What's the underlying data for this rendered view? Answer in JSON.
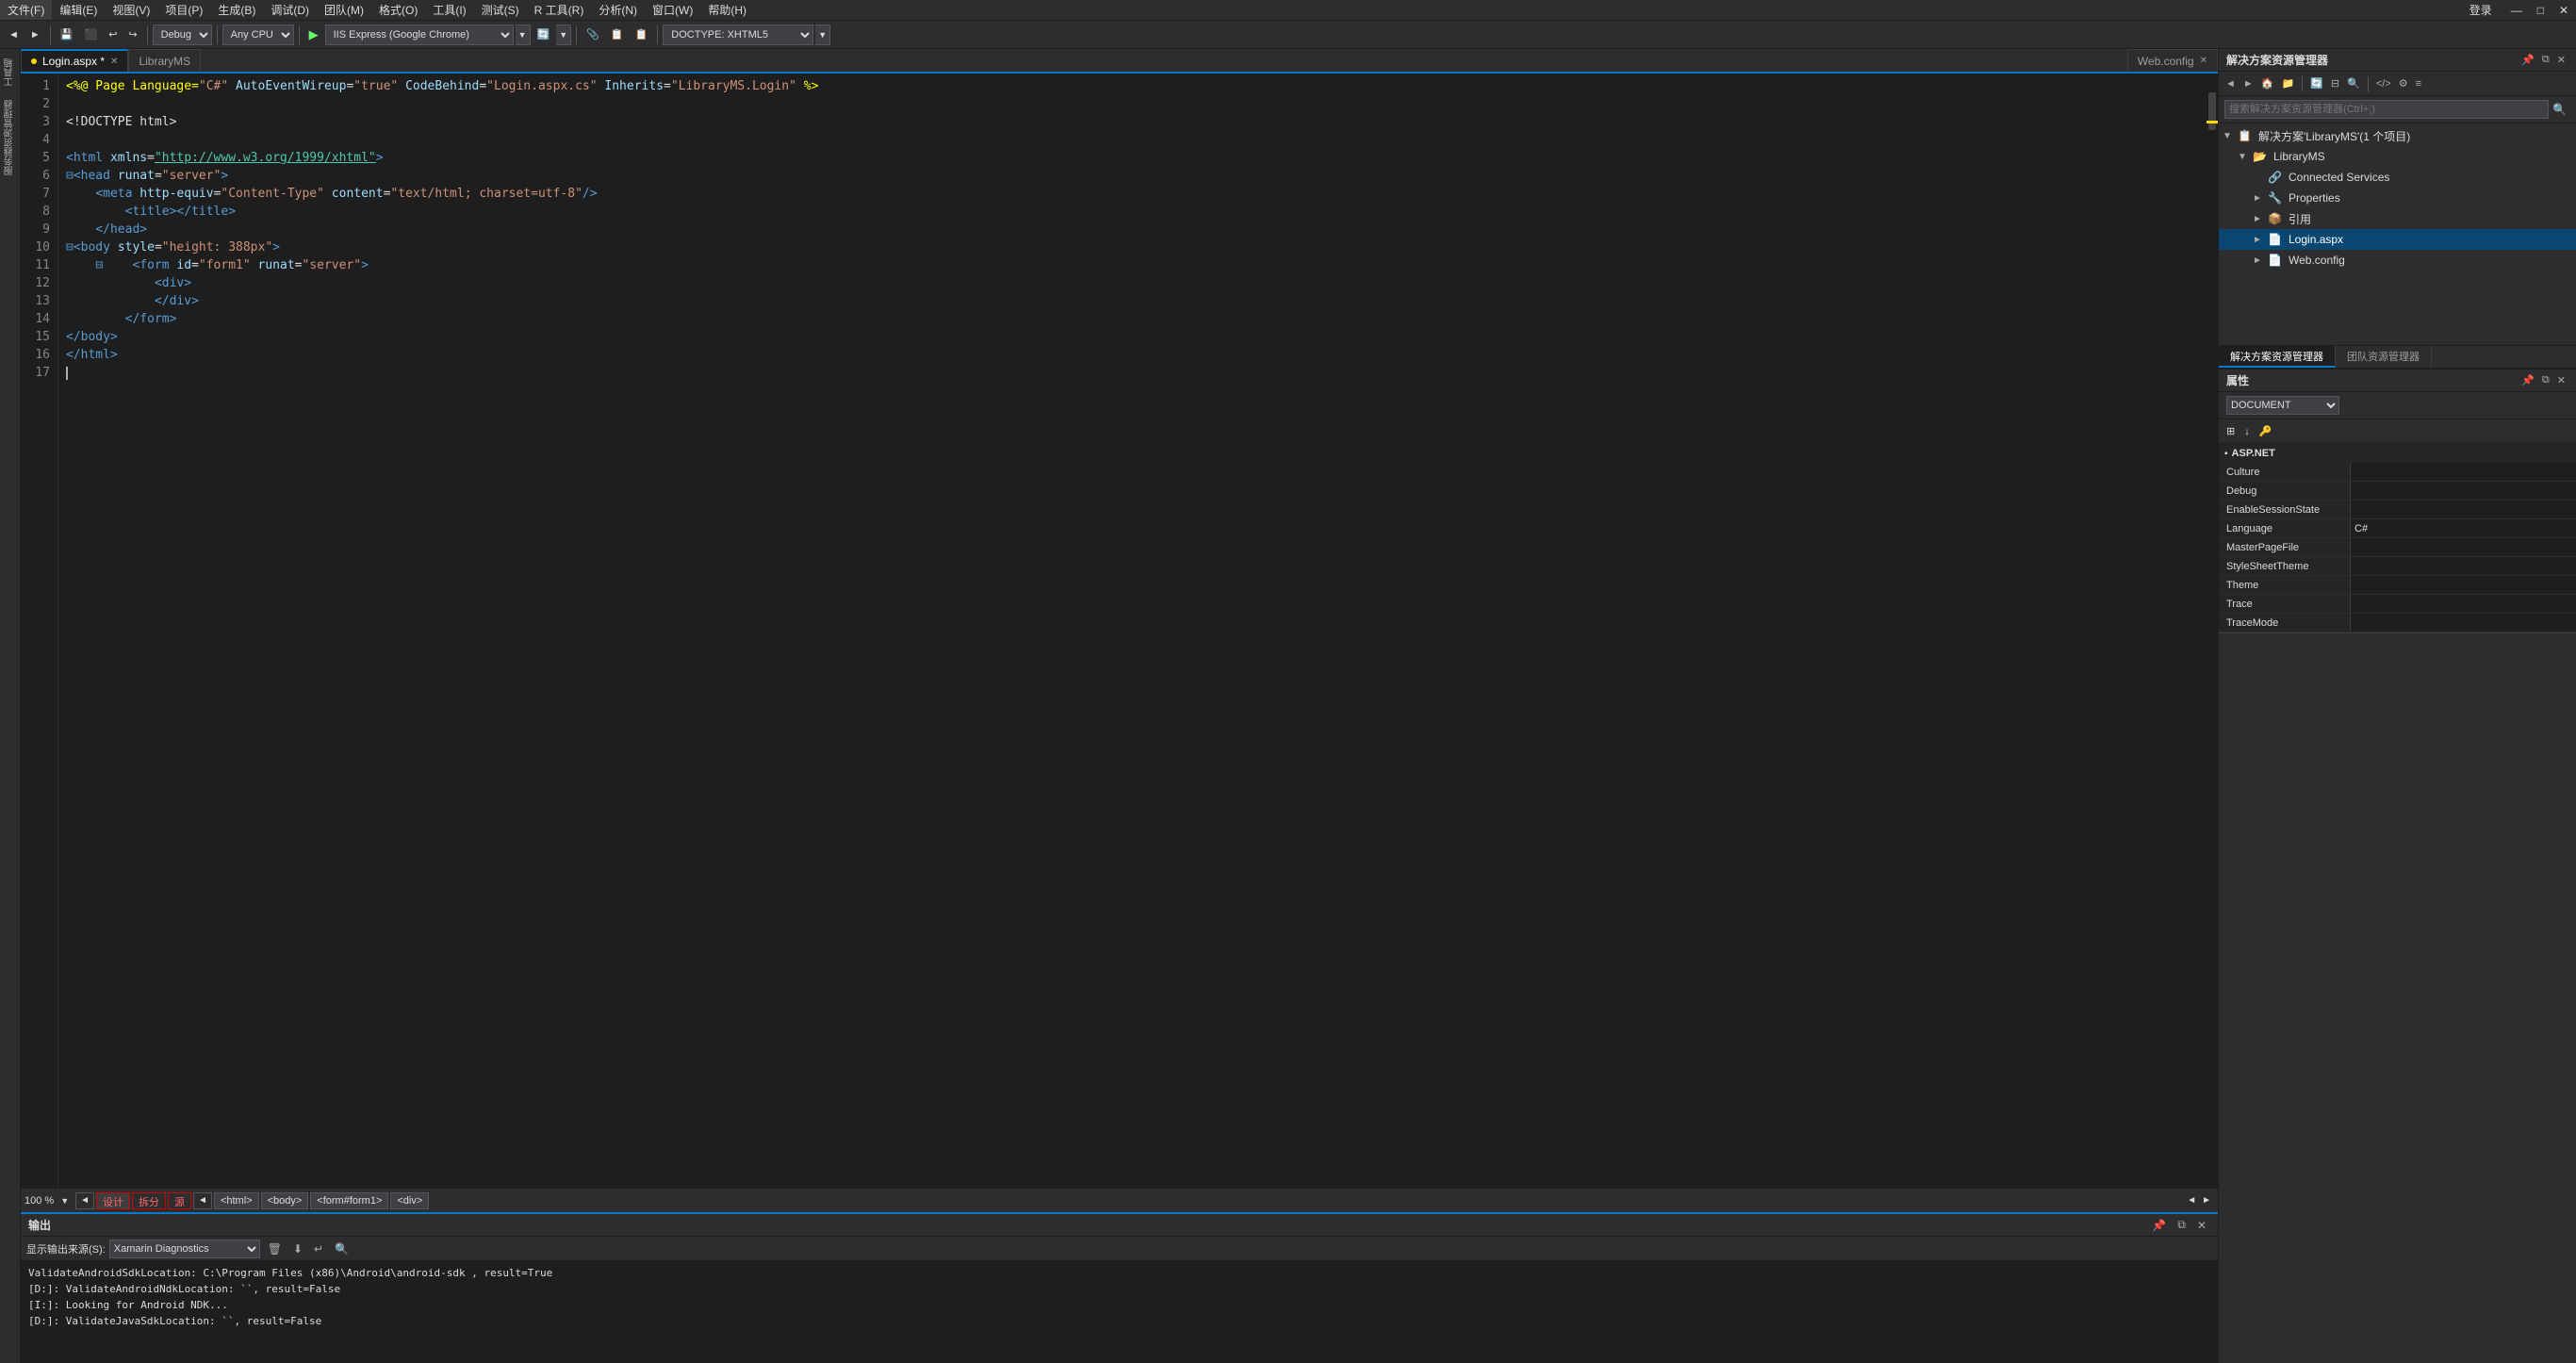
{
  "menubar": {
    "items": [
      "文件(F)",
      "编辑(E)",
      "视图(V)",
      "项目(P)",
      "生成(B)",
      "调试(D)",
      "团队(M)",
      "格式(O)",
      "工具(I)",
      "测试(S)",
      "R 工具(R)",
      "分析(N)",
      "窗口(W)",
      "帮助(H)"
    ],
    "login": "登录",
    "winctrl": [
      "□",
      "×"
    ]
  },
  "toolbar": {
    "debug_config": "Debug",
    "platform": "Any CPU",
    "run_label": "IIS Express (Google Chrome)",
    "doctype": "DOCTYPE: XHTML5"
  },
  "tabs": {
    "editor_tab1": "Login.aspx *",
    "editor_tab2": "LibraryMS",
    "web_config_tab": "Web.config"
  },
  "editor": {
    "lines": [
      {
        "num": 1,
        "content": "<%@ Page Language=\"C#\" AutoEventWireup=\"true\" CodeBehind=\"Login.aspx.cs\" Inherits=\"LibraryMS.Login\" %>"
      },
      {
        "num": 2,
        "content": ""
      },
      {
        "num": 3,
        "content": "<!DOCTYPE html>"
      },
      {
        "num": 4,
        "content": ""
      },
      {
        "num": 5,
        "content": "<html xmlns=\"http://www.w3.org/1999/xhtml\">"
      },
      {
        "num": 6,
        "content": "<head runat=\"server\">"
      },
      {
        "num": 7,
        "content": "    <meta http-equiv=\"Content-Type\" content=\"text/html; charset=utf-8\"/>"
      },
      {
        "num": 8,
        "content": "        <title></title>"
      },
      {
        "num": 9,
        "content": "    </head>"
      },
      {
        "num": 10,
        "content": "<body style=\"height: 388px\">"
      },
      {
        "num": 11,
        "content": "    <form id=\"form1\" runat=\"server\">"
      },
      {
        "num": 12,
        "content": "        <div>"
      },
      {
        "num": 13,
        "content": "        </div>"
      },
      {
        "num": 14,
        "content": "    </form>"
      },
      {
        "num": 15,
        "content": "</body>"
      },
      {
        "num": 16,
        "content": "</html>"
      },
      {
        "num": 17,
        "content": ""
      }
    ]
  },
  "design_bar": {
    "zoom": "100 %",
    "design_btn": "设计",
    "split_btn": "拆分",
    "source_btn": "源",
    "nav_left": "◄",
    "nav_right": "►",
    "breadcrumbs": [
      "<html>",
      "<body>",
      "<form#form1>",
      "<div>"
    ]
  },
  "output": {
    "title": "输出",
    "source_label": "显示输出来源(S):",
    "source_value": "Xamarin Diagnostics",
    "lines": [
      "        ValidateAndroidSdkLocation: C:\\Program Files (x86)\\Android\\android-sdk , result=True",
      "[D:]:        ValidateAndroidNdkLocation: ``, result=False",
      "[I:]:        Looking for Android NDK...",
      "[D:]:        ValidateJavaSdkLocation: ``, result=False"
    ]
  },
  "solution_explorer": {
    "title": "解决方案资源管理器",
    "search_placeholder": "搜索解决方案资源管理器(Ctrl+;)",
    "solution_label": "解决方案'LibraryMS'(1 个项目)",
    "project_label": "LibraryMS",
    "items": [
      {
        "label": "Connected Services",
        "indent": 3,
        "icon": "🔗"
      },
      {
        "label": "Properties",
        "indent": 3,
        "icon": "📁"
      },
      {
        "label": "引用",
        "indent": 3,
        "icon": "📦"
      },
      {
        "label": "Login.aspx",
        "indent": 3,
        "icon": "📄",
        "selected": true
      },
      {
        "label": "Web.config",
        "indent": 3,
        "icon": "📄"
      }
    ],
    "tab1": "解决方案资源管理器",
    "tab2": "团队资源管理器"
  },
  "properties": {
    "title": "属性",
    "type": "DOCUMENT",
    "section_aspnet": "ASP.NET",
    "rows": [
      {
        "name": "Culture",
        "value": ""
      },
      {
        "name": "Debug",
        "value": ""
      },
      {
        "name": "EnableSessionState",
        "value": ""
      },
      {
        "name": "Language",
        "value": "C#"
      },
      {
        "name": "MasterPageFile",
        "value": ""
      },
      {
        "name": "StyleSheetTheme",
        "value": ""
      },
      {
        "name": "Theme",
        "value": ""
      },
      {
        "name": "Trace",
        "value": ""
      },
      {
        "name": "TraceMode",
        "value": ""
      }
    ]
  }
}
